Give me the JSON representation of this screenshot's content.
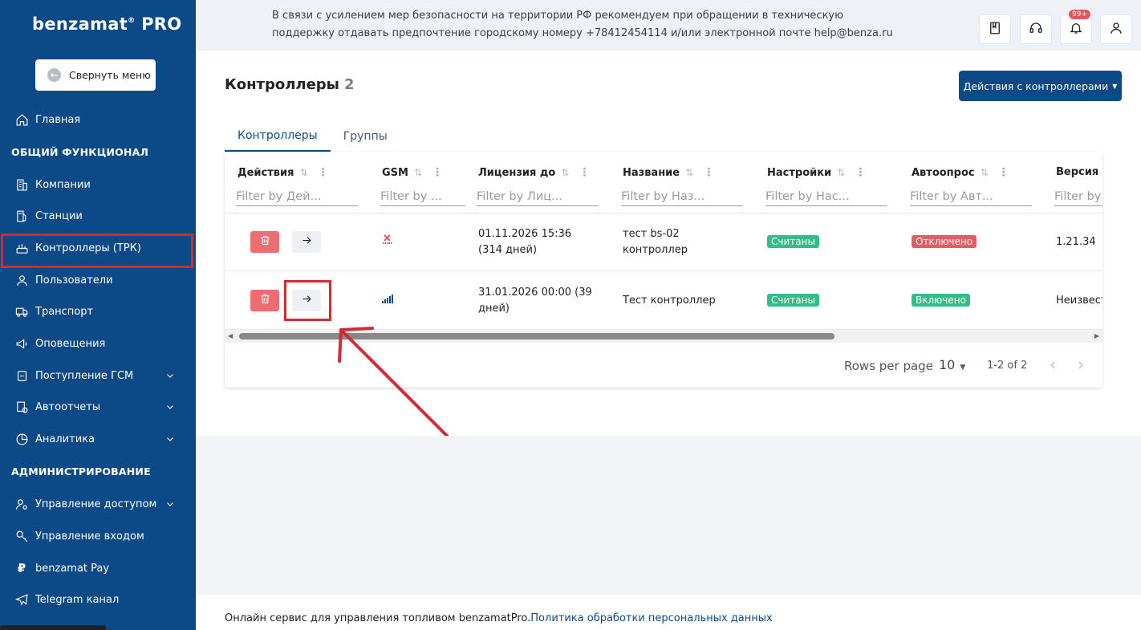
{
  "sidebar": {
    "logo": "benzamat",
    "logo_sup": "®",
    "logo_pro": "PRO",
    "collapse_label": "Свернуть меню",
    "items": [
      {
        "label": "Главная"
      },
      {
        "section": "ОБЩИЙ ФУНКЦИОНАЛ"
      },
      {
        "label": "Компании"
      },
      {
        "label": "Станции"
      },
      {
        "label": "Контроллеры (ТРК)"
      },
      {
        "label": "Пользователи"
      },
      {
        "label": "Транспорт"
      },
      {
        "label": "Оповещения"
      },
      {
        "label": "Поступление ГСМ"
      },
      {
        "label": "Автоотчеты"
      },
      {
        "label": "Аналитика"
      },
      {
        "section": "АДМИНИСТРИРОВАНИЕ"
      },
      {
        "label": "Управление доступом"
      },
      {
        "label": "Управление входом"
      },
      {
        "label": "benzamat Pay"
      },
      {
        "label": "Telegram канал"
      }
    ]
  },
  "banner": {
    "line1": "В связи с усилением мер безопасности на территории РФ рекомендуем при обращении в техническую",
    "line2": "поддержку отдавать предпочтение городскому номеру +78412454114 и/или электронной почте help@benza.ru",
    "notif_badge": "99+"
  },
  "main": {
    "title": "Контроллеры",
    "count": "2",
    "actions_label": "Действия с контроллерами",
    "tabs": [
      "Контроллеры",
      "Группы"
    ]
  },
  "table": {
    "columns": [
      {
        "label": "Действия",
        "filter": "Filter by Дей..."
      },
      {
        "label": "GSM",
        "filter": "Filter by ..."
      },
      {
        "label": "Лицензия до",
        "filter": "Filter by Лиц..."
      },
      {
        "label": "Название",
        "filter": "Filter by Наз..."
      },
      {
        "label": "Настройки",
        "filter": "Filter by Нас..."
      },
      {
        "label": "Автоопрос",
        "filter": "Filter by Авт..."
      },
      {
        "label": "Версия П",
        "filter": "Filter by"
      }
    ],
    "rows": [
      {
        "license_l1": "01.11.2026 15:36",
        "license_l2": "(314 дней)",
        "name_l1": "тест bs-02",
        "name_l2": "контроллер",
        "settings": "Считаны",
        "autopoll": "Отключено",
        "version": "1.21.34"
      },
      {
        "license_l1": "31.01.2026 00:00 (39",
        "license_l2": "дней)",
        "name_l1": "Тест контроллер",
        "name_l2": "",
        "settings": "Считаны",
        "autopoll": "Включено",
        "version": "Неизвест"
      }
    ],
    "rows_per_page_label": "Rows per page",
    "rows_per_page": "10",
    "range": "1-2 of 2"
  },
  "footer": {
    "text": "Онлайн сервис для управления топливом benzamatPro.",
    "link": "Политика обработки персональных данных"
  },
  "colors": {
    "sidebar": "#0b4a86",
    "accent_red": "#d42a32",
    "tag_green": "#2fbf87",
    "tag_red": "#e35d63"
  }
}
